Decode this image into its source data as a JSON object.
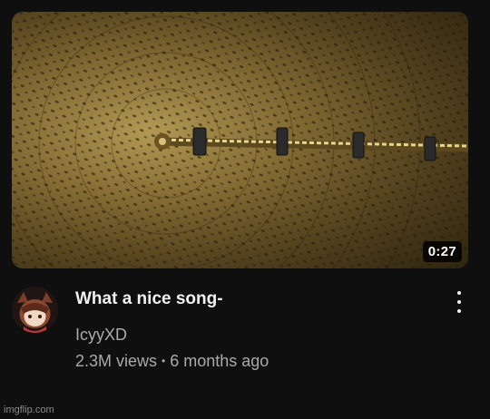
{
  "video": {
    "title": "What a nice song-",
    "channel": "IcyyXD",
    "views": "2.3M views",
    "separator": "•",
    "age": "6 months ago",
    "duration": "0:27"
  },
  "icons": {
    "more": "kebab-vertical-icon",
    "avatar": "channel-avatar"
  },
  "colors": {
    "background": "#0f0f0f",
    "title": "#f1f1f1",
    "secondary": "#aaaaaa"
  },
  "watermark": "imgflip.com"
}
